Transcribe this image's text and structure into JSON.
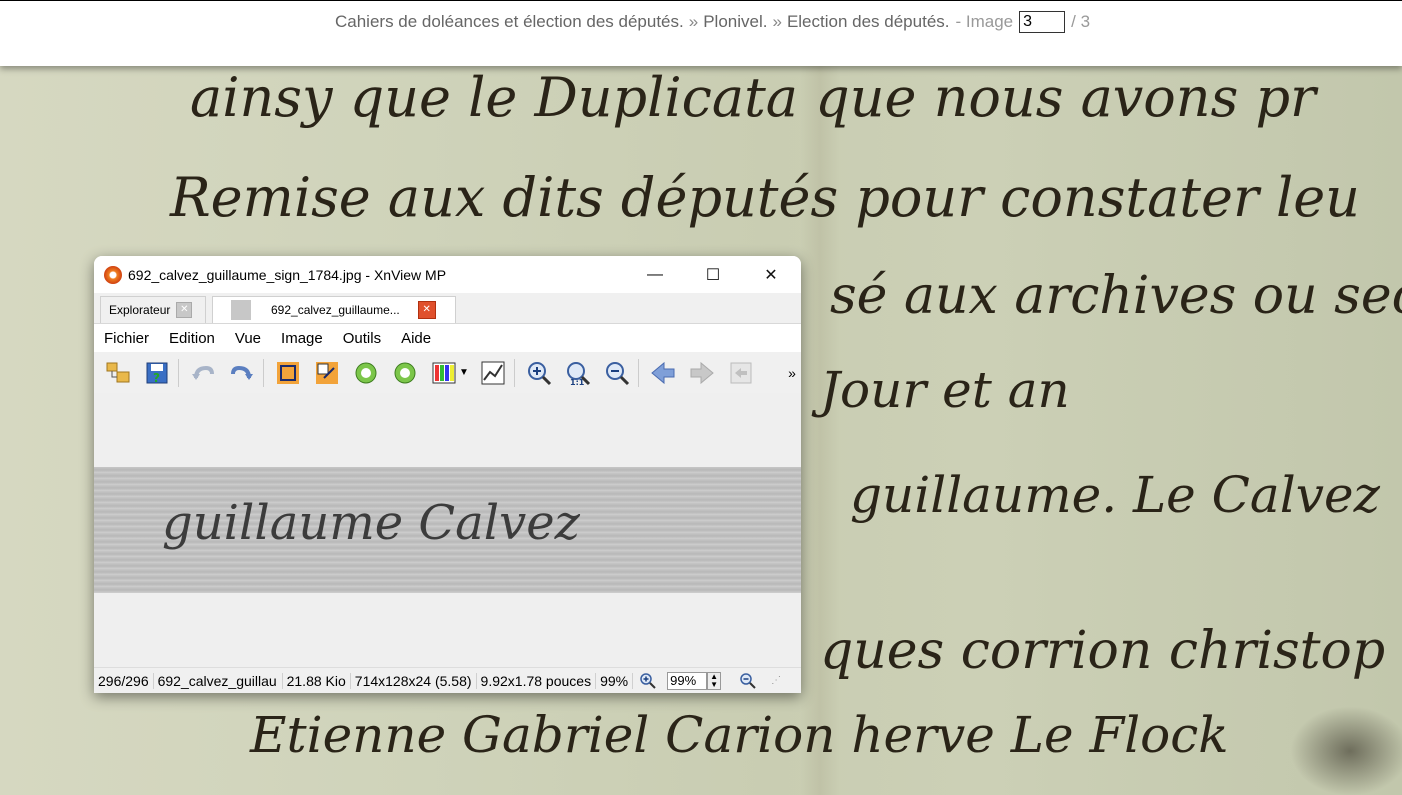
{
  "breadcrumb": {
    "items": [
      "Cahiers de doléances et élection des députés.",
      "Plonivel.",
      "Election des députés."
    ],
    "separator": "»",
    "image_label": "- Image",
    "image_value": "3",
    "image_total": "/ 3"
  },
  "manuscript": {
    "lines": [
      "ainsy que le Duplicata que nous avons pr",
      "Remise aux dits députés pour constater leu",
      "sé aux archives ou secr",
      "Jour et an",
      "guillaume. Le Calvez",
      "ques corrion christop",
      "Etienne Gabriel Carion   herve Le Flock"
    ]
  },
  "xnview": {
    "title": "692_calvez_guillaume_sign_1784.jpg - XnView MP",
    "controls": {
      "minimize": "—",
      "maximize": "☐",
      "close": "✕"
    },
    "tabs": [
      {
        "label": "Explorateur"
      },
      {
        "label": "692_calvez_guillaume..."
      }
    ],
    "tab_close": "✕",
    "menu": [
      "Fichier",
      "Edition",
      "Vue",
      "Image",
      "Outils",
      "Aide"
    ],
    "toolbar_overflow": "»",
    "image_text": "guillaume Calvez",
    "status": {
      "index": "296/296",
      "filename": "692_calvez_guillau",
      "size": "21.88 Kio",
      "dims": "714x128x24 (5.58)",
      "inches": "9.92x1.78 pouces",
      "zoom_pct": "99%",
      "zoom_box": "99%"
    }
  }
}
